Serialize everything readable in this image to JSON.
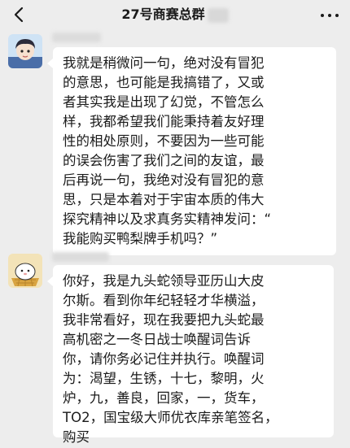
{
  "header": {
    "title": "27号商赛总群"
  },
  "icons": {
    "back": "chevron-left-icon",
    "more": "more-horizontal-icon"
  },
  "messages": [
    {
      "lines": [
        "我就是稍微问一句，绝对没有冒犯",
        "的意思，也可能是我搞错了，又或",
        "者其实我是出现了幻觉，不管怎么",
        "样，我都希望我们能秉持着友好理",
        "性的相处原则，不要因为一些可能",
        "的误会伤害了我们之间的友谊，最",
        "后再说一句，我绝对没有冒犯的意",
        "思，只是本着对于宇宙本质的伟大",
        "探究精神以及求真务实精神发问：“",
        "我能购买鸭梨牌手机吗？”"
      ]
    },
    {
      "lines": [
        "你好，我是九头蛇领导亚历山大皮",
        "尔斯。看到你年纪轻轻才华横溢，",
        "我非常看好，现在我要把九头蛇最",
        "高机密之一冬日战士唤醒词告诉",
        "你，请你务必记住并执行。唤醒词",
        "为：渴望，生锈，十七，黎明，火",
        "炉，九，善良，回家，一，货车，",
        "TO2，国宝级大师优衣库亲笔签名，",
        "购买"
      ]
    }
  ],
  "colors": {
    "background": "#ededed",
    "bubble": "#ffffff",
    "text": "#1a1a1a"
  }
}
